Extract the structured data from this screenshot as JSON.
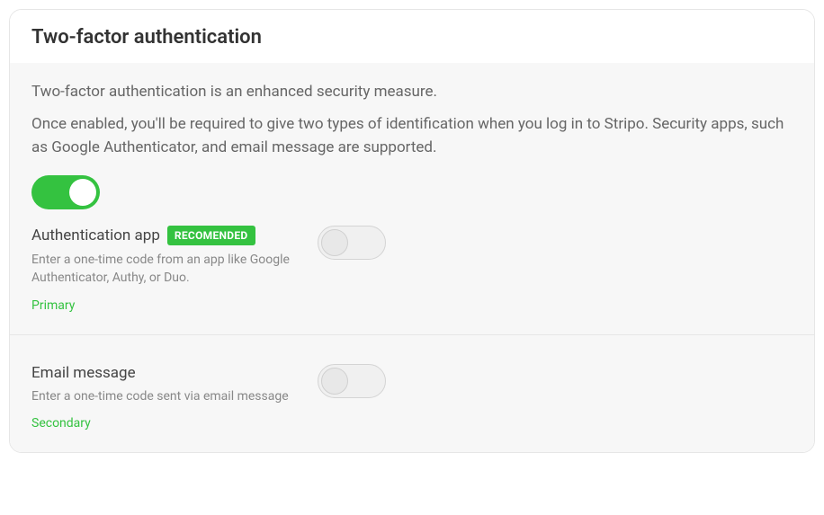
{
  "header": {
    "title": "Two-factor authentication"
  },
  "intro": {
    "line1": "Two-factor authentication is an enhanced security measure.",
    "line2": "Once enabled, you'll be required to give two types of identification when you log in to Stripo. Security apps, such as Google Authenticator, and email message are supported."
  },
  "master_toggle": {
    "state": "on"
  },
  "methods": {
    "auth_app": {
      "title": "Authentication app",
      "badge": "RECOMENDED",
      "desc": "Enter a one-time code from an app like Google Authenticator, Authy, or Duo.",
      "status": "Primary",
      "toggle_state": "off"
    },
    "email": {
      "title": "Email message",
      "desc": "Enter a one-time code sent via email message",
      "status": "Secondary",
      "toggle_state": "off"
    }
  }
}
